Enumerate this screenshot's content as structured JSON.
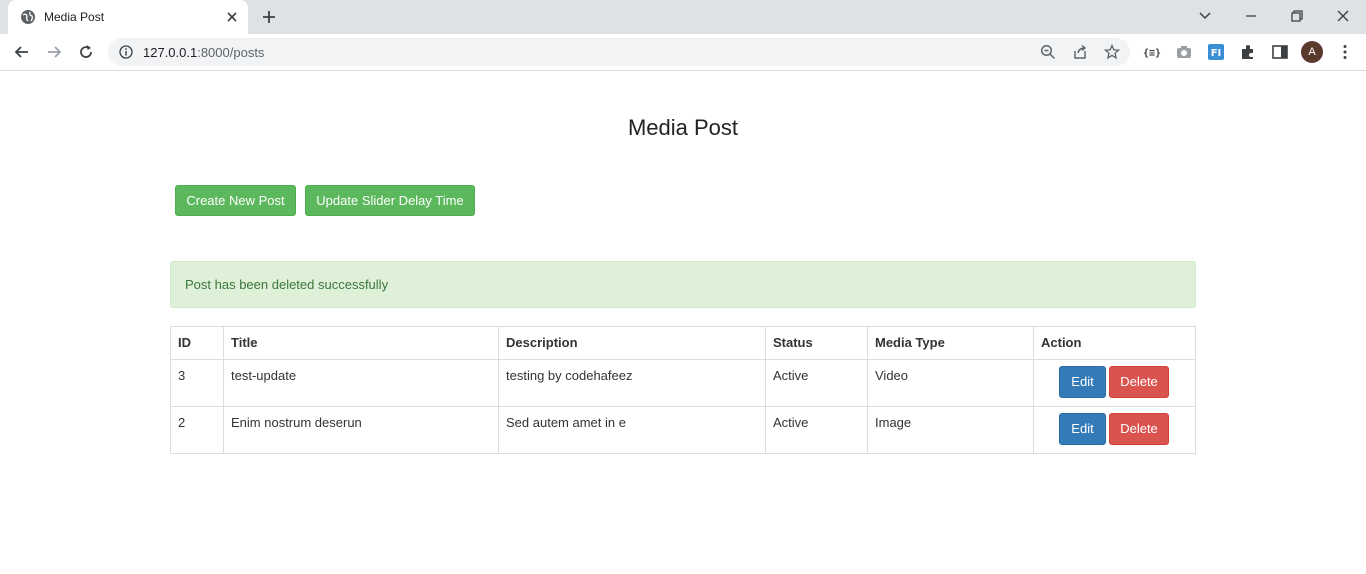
{
  "browser": {
    "tab_title": "Media Post",
    "url_host": "127.0.0.1",
    "url_path": ":8000/posts",
    "avatar_letter": "A"
  },
  "page": {
    "title": "Media Post",
    "create_button": "Create New Post",
    "slider_button": "Update Slider Delay Time",
    "alert": "Post has been deleted successfully"
  },
  "table": {
    "headers": [
      "ID",
      "Title",
      "Description",
      "Status",
      "Media Type",
      "Action"
    ],
    "rows": [
      {
        "id": "3",
        "title": "test-update",
        "description": "testing by codehafeez",
        "status": "Active",
        "media_type": "Video"
      },
      {
        "id": "2",
        "title": "Enim nostrum deserun",
        "description": "Sed autem amet in e",
        "status": "Active",
        "media_type": "Image"
      }
    ],
    "edit_label": "Edit",
    "delete_label": "Delete"
  },
  "colors": {
    "success": "#5cb85c",
    "primary": "#337ab7",
    "danger": "#d9534f",
    "alert_bg": "#dff0d8"
  }
}
